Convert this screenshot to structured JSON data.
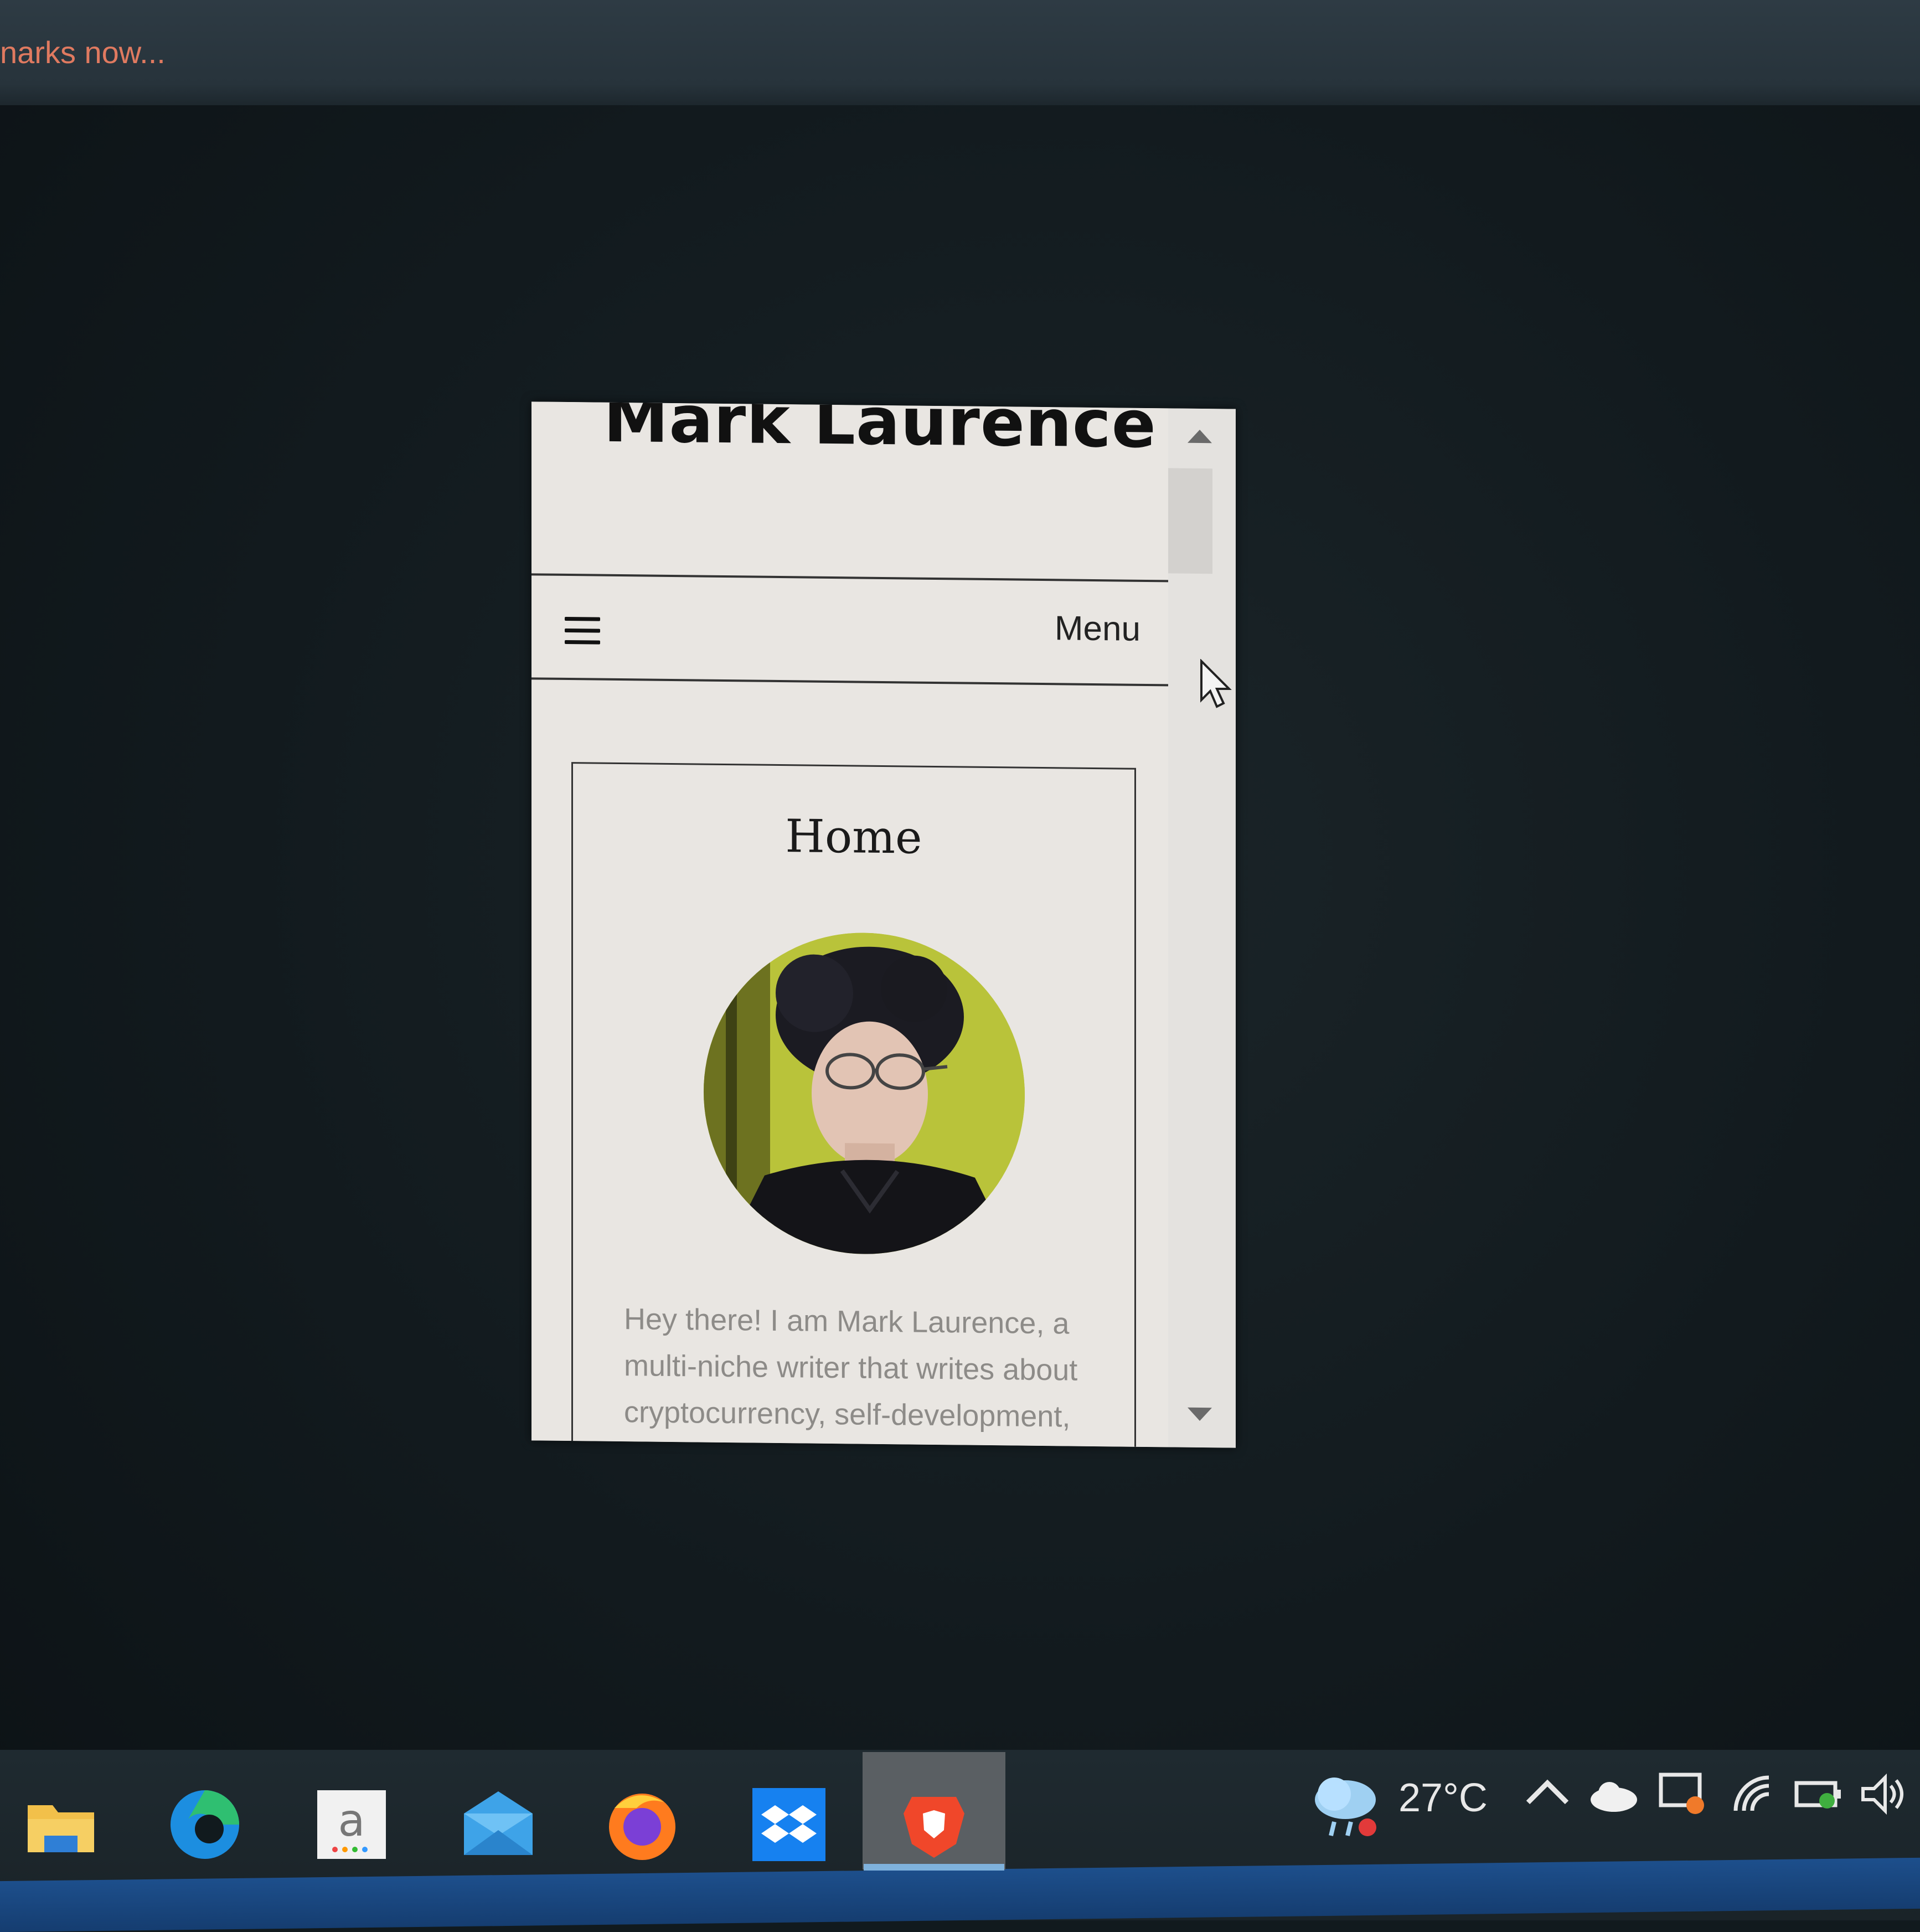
{
  "top_strip": {
    "text": "narks now..."
  },
  "site": {
    "title": "Mark Laurence",
    "menu_label": "Menu",
    "card_title": "Home",
    "bio_lines": [
      "Hey there! I am Mark Laurence, a",
      "multi-niche writer that writes about",
      "cryptocurrency, self-development,"
    ]
  },
  "taskbar": {
    "apps": [
      {
        "name": "file-explorer-icon"
      },
      {
        "name": "edge-icon"
      },
      {
        "name": "amazon-icon"
      },
      {
        "name": "mail-icon"
      },
      {
        "name": "firefox-icon"
      },
      {
        "name": "dropbox-icon"
      },
      {
        "name": "brave-icon",
        "active": true
      }
    ],
    "weather": "27°C"
  },
  "colors": {
    "desktop": "#111a1e",
    "page_bg": "#e9e6e2",
    "taskbar_accent": "#1d4f8c",
    "notice_text": "#e07a60"
  }
}
